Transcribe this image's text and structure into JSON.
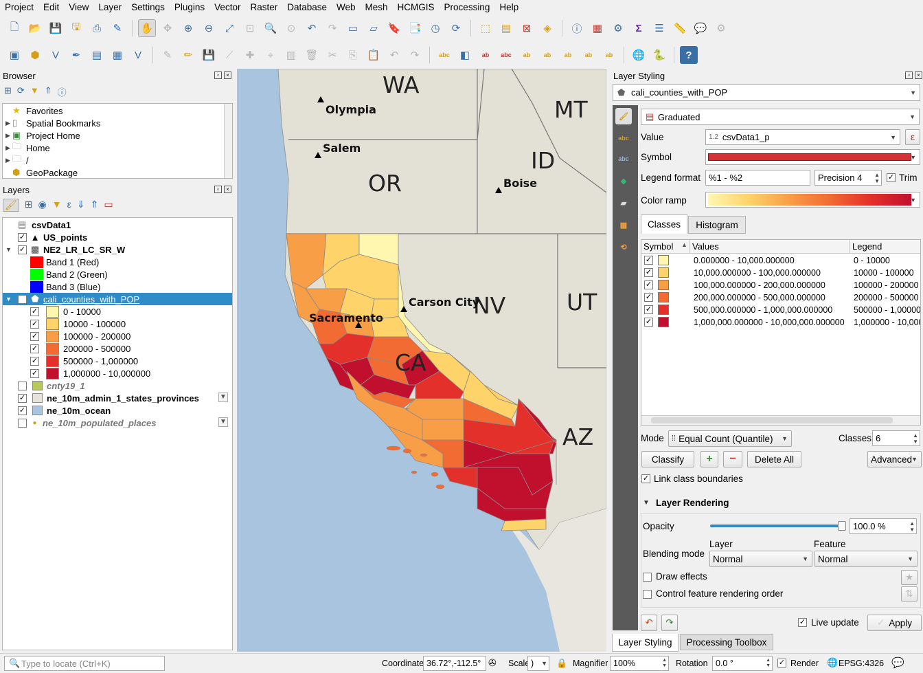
{
  "menu": [
    "Project",
    "Edit",
    "View",
    "Layer",
    "Settings",
    "Plugins",
    "Vector",
    "Raster",
    "Database",
    "Web",
    "Mesh",
    "HCMGIS",
    "Processing",
    "Help"
  ],
  "browser": {
    "title": "Browser",
    "items": [
      "Favorites",
      "Spatial Bookmarks",
      "Project Home",
      "Home",
      "/",
      "GeoPackage"
    ]
  },
  "layers": {
    "title": "Layers",
    "items": [
      {
        "name": "csvData1"
      },
      {
        "name": "US_points"
      },
      {
        "name": "NE2_LR_LC_SR_W"
      },
      {
        "name": "Band 1 (Red)",
        "color": "#ff0000"
      },
      {
        "name": "Band 2 (Green)",
        "color": "#00ff00"
      },
      {
        "name": "Band 3 (Blue)",
        "color": "#0000ff"
      },
      {
        "name": "cali_counties_with_POP"
      },
      {
        "name": "0 - 10000",
        "color": "#fff7b0"
      },
      {
        "name": "10000 - 100000",
        "color": "#fdd36a"
      },
      {
        "name": "100000 - 200000",
        "color": "#f89e47"
      },
      {
        "name": "200000 - 500000",
        "color": "#f26b32"
      },
      {
        "name": "500000 - 1,000000",
        "color": "#e3302a"
      },
      {
        "name": "1,000000 - 10,000000",
        "color": "#c1102e"
      },
      {
        "name": "cnty19_1",
        "color": "#b5c95a"
      },
      {
        "name": "ne_10m_admin_1_states_provinces",
        "color": "#e8e3d8"
      },
      {
        "name": "ne_10m_ocean",
        "color": "#a9c4de"
      },
      {
        "name": "ne_10m_populated_places"
      }
    ]
  },
  "map": {
    "states": [
      "WA",
      "MT",
      "ID",
      "OR",
      "NV",
      "UT",
      "CA",
      "AZ"
    ],
    "cities": [
      "Olympia",
      "Salem",
      "Boise",
      "Carson City",
      "Sacramento"
    ]
  },
  "styling": {
    "title": "Layer Styling",
    "layer": "cali_counties_with_POP",
    "renderer": "Graduated",
    "value_label": "Value",
    "value": "csvData1_p",
    "value_prefix": "1.2",
    "symbol_label": "Symbol",
    "legend_format_label": "Legend format",
    "legend_format": "%1 - %2",
    "precision": "Precision 4",
    "trim": "Trim",
    "color_ramp_label": "Color ramp",
    "tabs": [
      "Classes",
      "Histogram"
    ],
    "columns": [
      "Symbol",
      "Values",
      "Legend"
    ],
    "classes": [
      {
        "values": "0.000000 - 10,000.000000",
        "legend": "0 - 10000",
        "color": "#fff7b0"
      },
      {
        "values": "10,000.000000 - 100,000.000000",
        "legend": "10000 - 100000",
        "color": "#fdd36a"
      },
      {
        "values": "100,000.000000 - 200,000.000000",
        "legend": "100000 - 200000",
        "color": "#f89e47"
      },
      {
        "values": "200,000.000000 - 500,000.000000",
        "legend": "200000 - 500000",
        "color": "#f26b32"
      },
      {
        "values": "500,000.000000 - 1,000,000.000000",
        "legend": "500000 - 1,000000",
        "color": "#e3302a"
      },
      {
        "values": "1,000,000.000000 - 10,000,000.000000",
        "legend": "1,000000 - 10,000000",
        "color": "#c1102e"
      }
    ],
    "mode_label": "Mode",
    "mode": "Equal Count (Quantile)",
    "classes_label": "Classes",
    "classes_count": "6",
    "classify": "Classify",
    "delete_all": "Delete All",
    "advanced": "Advanced",
    "link_boundaries": "Link class boundaries",
    "layer_rendering": "Layer Rendering",
    "opacity_label": "Opacity",
    "opacity": "100.0 %",
    "opacity_fraction": 1.0,
    "blending_label": "Blending mode",
    "layer_sub": "Layer",
    "feature_sub": "Feature",
    "blend_layer": "Normal",
    "blend_feature": "Normal",
    "draw_effects": "Draw effects",
    "control_order": "Control feature rendering order",
    "live_update": "Live update",
    "apply": "Apply",
    "bottom_tabs": [
      "Layer Styling",
      "Processing Toolbox"
    ]
  },
  "status": {
    "locate_placeholder": "Type to locate (Ctrl+K)",
    "coordinate_label": "Coordinate",
    "coordinate": "36.72°,-112.5°",
    "scale_label": "Scale",
    "scale": ")",
    "magnifier_label": "Magnifier",
    "magnifier": "100%",
    "rotation_label": "Rotation",
    "rotation": "0.0 °",
    "render": "Render",
    "crs": "EPSG:4326"
  },
  "colors": {
    "selection": "#308cc6",
    "accent": "#3a6ea5"
  }
}
